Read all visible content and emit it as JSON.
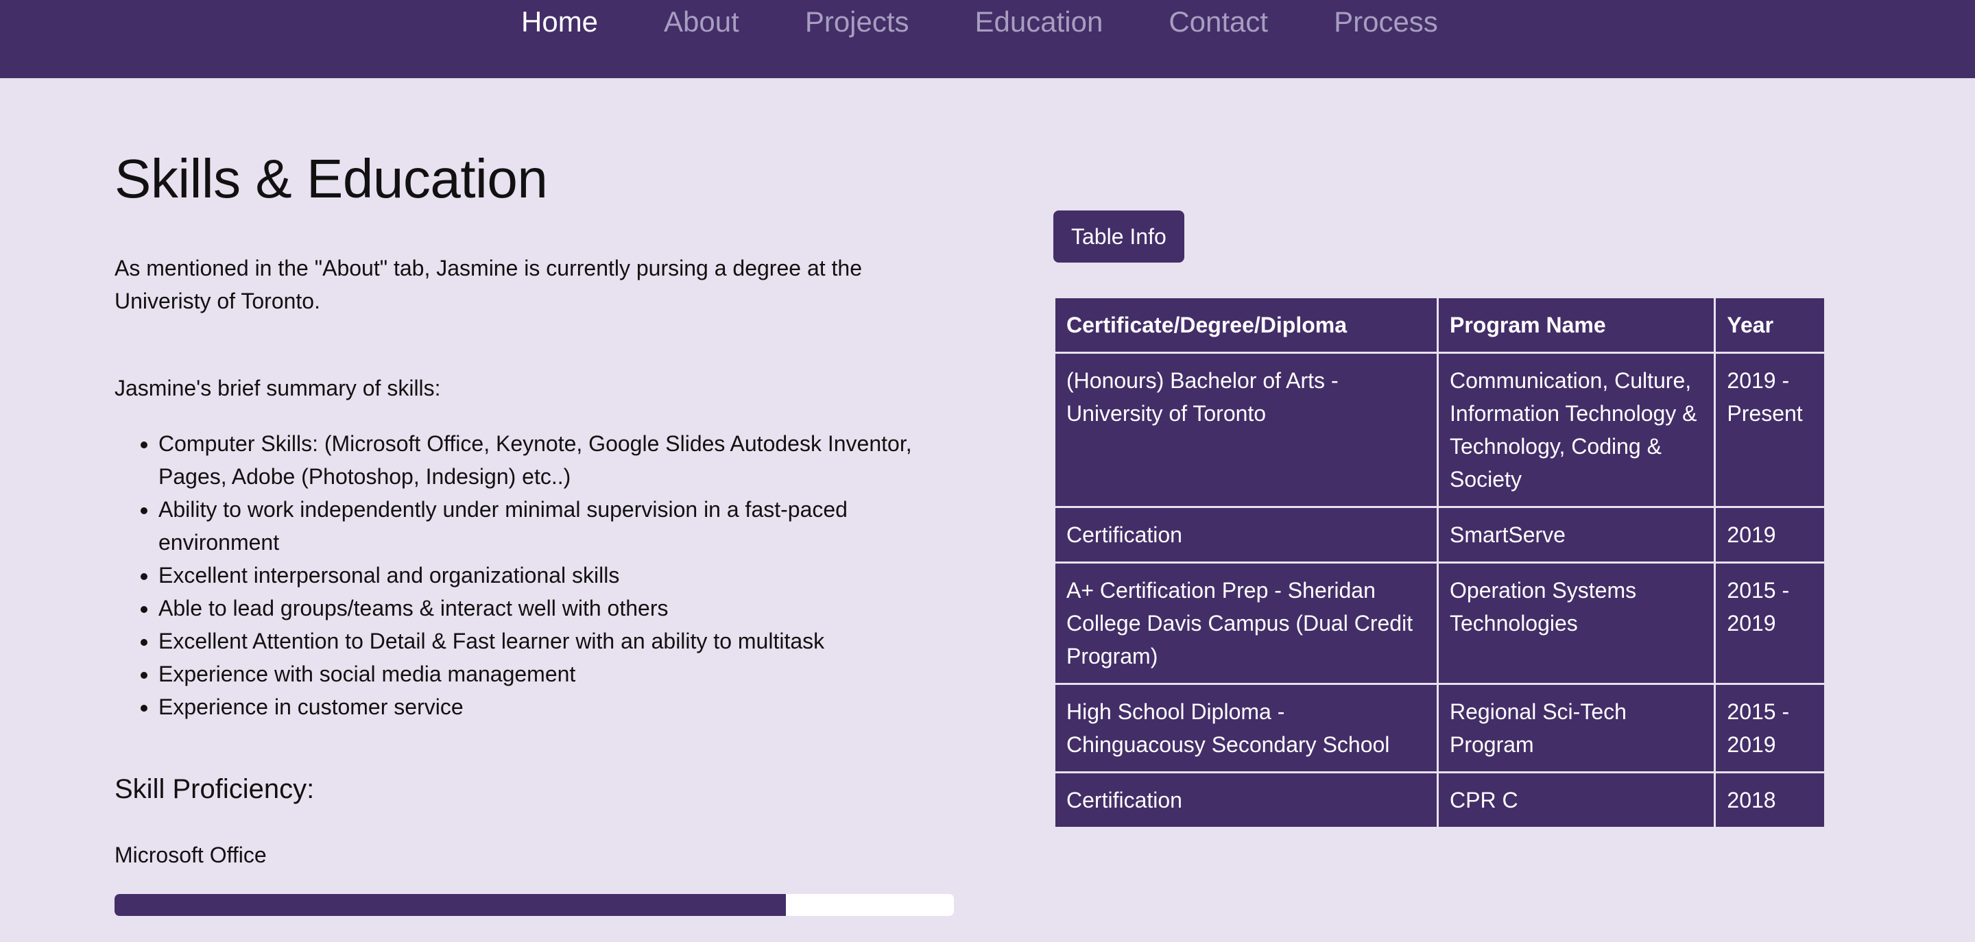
{
  "nav": {
    "items": [
      {
        "label": "Home",
        "active": true
      },
      {
        "label": "About",
        "active": false
      },
      {
        "label": "Projects",
        "active": false
      },
      {
        "label": "Education",
        "active": false
      },
      {
        "label": "Contact",
        "active": false
      },
      {
        "label": "Process",
        "active": false
      }
    ]
  },
  "main": {
    "title": "Skills & Education",
    "intro": "As mentioned in the \"About\" tab, Jasmine is currently pursing a degree at the Univeristy of Toronto.",
    "summary_label": "Jasmine's brief summary of skills:",
    "skills": [
      "Computer Skills: (Microsoft Office, Keynote, Google Slides Autodesk Inventor, Pages, Adobe (Photoshop, Indesign) etc..)",
      "Ability to work independently under minimal supervision in a fast-paced environment",
      "Excellent interpersonal and organizational skills",
      "Able to lead groups/teams & interact well with others",
      "Excellent Attention to Detail & Fast learner with an ability to multitask",
      "Experience with social media management",
      "Experience in customer service"
    ],
    "proficiency_heading": "Skill Proficiency:",
    "proficiency": [
      {
        "label": "Microsoft Office",
        "percent": 80
      }
    ]
  },
  "table_section": {
    "button_label": "Table Info",
    "headers": [
      "Certificate/Degree/Diploma",
      "Program Name",
      "Year"
    ],
    "rows": [
      [
        "(Honours) Bachelor of Arts - University of Toronto",
        "Communication, Culture, Information Technology & Technology, Coding & Society",
        "2019 - Present"
      ],
      [
        "Certification",
        "SmartServe",
        "2019"
      ],
      [
        "A+ Certification Prep - Sheridan College Davis Campus (Dual Credit Program)",
        "Operation Systems Technologies",
        "2015 - 2019"
      ],
      [
        "High School Diploma - Chinguacousy Secondary School",
        "Regional Sci-Tech Program",
        "2015 - 2019"
      ],
      [
        "Certification",
        "CPR C",
        "2018"
      ]
    ]
  },
  "colors": {
    "primary": "#432e68",
    "background": "#e8e1ef",
    "nav_inactive": "#a79ec0"
  }
}
